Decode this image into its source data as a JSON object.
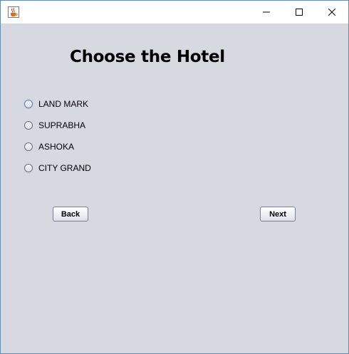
{
  "window": {
    "icon": "java-coffee-cup-icon",
    "controls": [
      "minimize-icon",
      "maximize-icon",
      "close-icon"
    ]
  },
  "main": {
    "heading": "Choose the Hotel",
    "hotels": [
      {
        "label": "LAND MARK",
        "selected": false,
        "focused": true
      },
      {
        "label": "SUPRABHA",
        "selected": false,
        "focused": false
      },
      {
        "label": "ASHOKA",
        "selected": false,
        "focused": false
      },
      {
        "label": "CITY GRAND",
        "selected": false,
        "focused": false
      }
    ],
    "back_label": "Back",
    "next_label": "Next"
  },
  "colors": {
    "panel_background": "#d6d9e0",
    "titlebar": "#ffffff",
    "desktop": "#4a7fa8"
  }
}
